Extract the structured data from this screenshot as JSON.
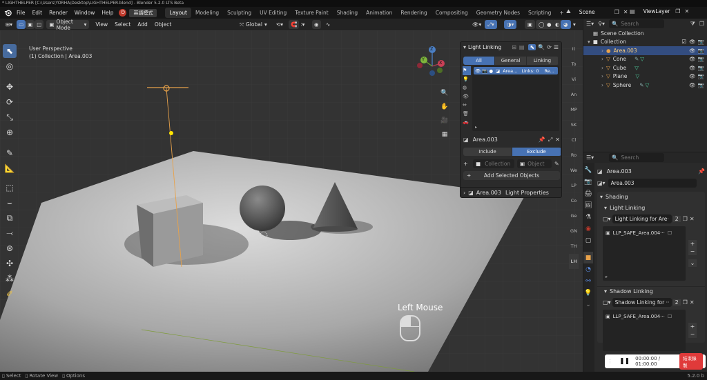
{
  "window": {
    "title": "* LIGHTHELPER [C:\\Users\\YORHA\\Desktop\\LIGHTHELPER.blend] - Blender 5.2.0 LTS Beta"
  },
  "menu": {
    "items": [
      "File",
      "Edit",
      "Render",
      "Window",
      "Help"
    ],
    "ime_label": "英語模式"
  },
  "workspaces": [
    "Layout",
    "Modeling",
    "Sculpting",
    "UV Editing",
    "Texture Paint",
    "Shading",
    "Animation",
    "Rendering",
    "Compositing",
    "Geometry Nodes",
    "Scripting"
  ],
  "workspace_active": "Layout",
  "scene": {
    "label": "Scene"
  },
  "view_layer": {
    "label": "ViewLayer"
  },
  "header3d": {
    "mode": "Object Mode",
    "menus": [
      "View",
      "Select",
      "Add",
      "Object"
    ],
    "orientation": "Global",
    "options": "Options"
  },
  "viewport": {
    "perspective": "User Perspective",
    "context": "(1) Collection | Area.003",
    "mouse_hint": "Left Mouse",
    "gizmo": {
      "x": "X",
      "y": "Y",
      "z": "Z"
    }
  },
  "npanel_tabs": [
    "It",
    "To",
    "Vi",
    "An",
    "MP",
    "SK",
    "Cl",
    "Ro",
    "We",
    "LP",
    "Co",
    "Ge",
    "GN",
    "TH",
    "LH"
  ],
  "light_linking": {
    "header": "Light Linking",
    "tabs": [
      "All",
      "General",
      "Linking"
    ],
    "item": {
      "name": "Area...",
      "links": "Links: 0",
      "action": "Re..."
    },
    "selected": "Area.003",
    "include": "Include",
    "exclude": "Exclude",
    "collection_placeholder": "Collection",
    "object_placeholder": "Object",
    "add_selected": "Add Selected Objects",
    "footer": "Area.003",
    "footer_label": "Light Properties"
  },
  "outliner": {
    "search_placeholder": "Search",
    "root": "Scene Collection",
    "collection": "Collection",
    "items": [
      {
        "name": "Area.003",
        "selected": true
      },
      {
        "name": "Cone",
        "selected": false
      },
      {
        "name": "Cube",
        "selected": false
      },
      {
        "name": "Plane",
        "selected": false
      },
      {
        "name": "Sphere",
        "selected": false
      }
    ]
  },
  "properties": {
    "search_placeholder": "Search",
    "object_name": "Area.003",
    "data_name": "Area.003",
    "shading": "Shading",
    "light_linking": "Light Linking",
    "ll_collection": "Light Linking for Are···",
    "ll_count": "2",
    "ll_item": "LLP_SAFE_Area.004···",
    "shadow_linking": "Shadow Linking",
    "sl_collection": "Shadow Linking for ···",
    "sl_count": "2",
    "sl_item": "LLP_SAFE_Area.004···"
  },
  "status": {
    "select": "Select",
    "rotate": "Rotate View",
    "options": "Options",
    "version": "5.2.0 b"
  },
  "recorder": {
    "time": "00:00:00 / 01:00:00",
    "stop": "結束錄製"
  },
  "colors": {
    "accent": "#4772b3",
    "selection": "#334d80",
    "light": "#e8a24a",
    "record_red": "#e03a3a",
    "active_tab": "#476b9e"
  }
}
